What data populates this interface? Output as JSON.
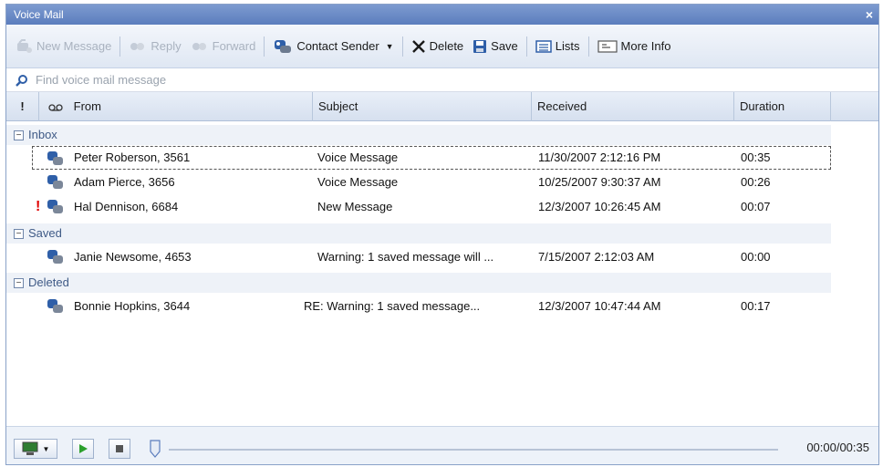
{
  "window": {
    "title": "Voice Mail",
    "close_glyph": "×"
  },
  "toolbar": {
    "new_message": "New Message",
    "reply": "Reply",
    "forward": "Forward",
    "contact_sender": "Contact Sender",
    "contact_sender_arrow": "▼",
    "delete": "Delete",
    "save": "Save",
    "lists": "Lists",
    "more_info": "More Info"
  },
  "search": {
    "placeholder": "Find voice mail message"
  },
  "columns": {
    "priority": "!",
    "from": "From",
    "subject": "Subject",
    "received": "Received",
    "duration": "Duration"
  },
  "groups": {
    "inbox": {
      "label": "Inbox",
      "toggle": "−"
    },
    "saved": {
      "label": "Saved",
      "toggle": "−"
    },
    "deleted": {
      "label": "Deleted",
      "toggle": "−"
    }
  },
  "messages": [
    {
      "urgent": "",
      "from": "Peter Roberson, 3561",
      "subject": "Voice Message",
      "received": "11/30/2007 2:12:16 PM",
      "duration": "00:35"
    },
    {
      "urgent": "",
      "from": "Adam Pierce, 3656",
      "subject": "Voice Message",
      "received": "10/25/2007 9:30:37 AM",
      "duration": "00:26"
    },
    {
      "urgent": "!",
      "from": "Hal Dennison, 6684",
      "subject": "New Message",
      "received": "12/3/2007 10:26:45 AM",
      "duration": "00:07"
    },
    {
      "urgent": "",
      "from": "Janie Newsome, 4653",
      "subject": "Warning: 1 saved message will ...",
      "received": "7/15/2007 2:12:03 AM",
      "duration": "00:00"
    },
    {
      "urgent": "",
      "from": "Bonnie Hopkins, 3644",
      "subject": "RE:  Warning: 1 saved message...",
      "received": "12/3/2007 10:47:44 AM",
      "duration": "00:17"
    }
  ],
  "player": {
    "dropdown_arrow": "▼",
    "time": "00:00/00:35",
    "progress": 0
  },
  "icons": {
    "search": "search-icon",
    "voicemail_column": "voicemail-icon",
    "message": "voice-message-icon",
    "accent": "#2f5fa8"
  }
}
